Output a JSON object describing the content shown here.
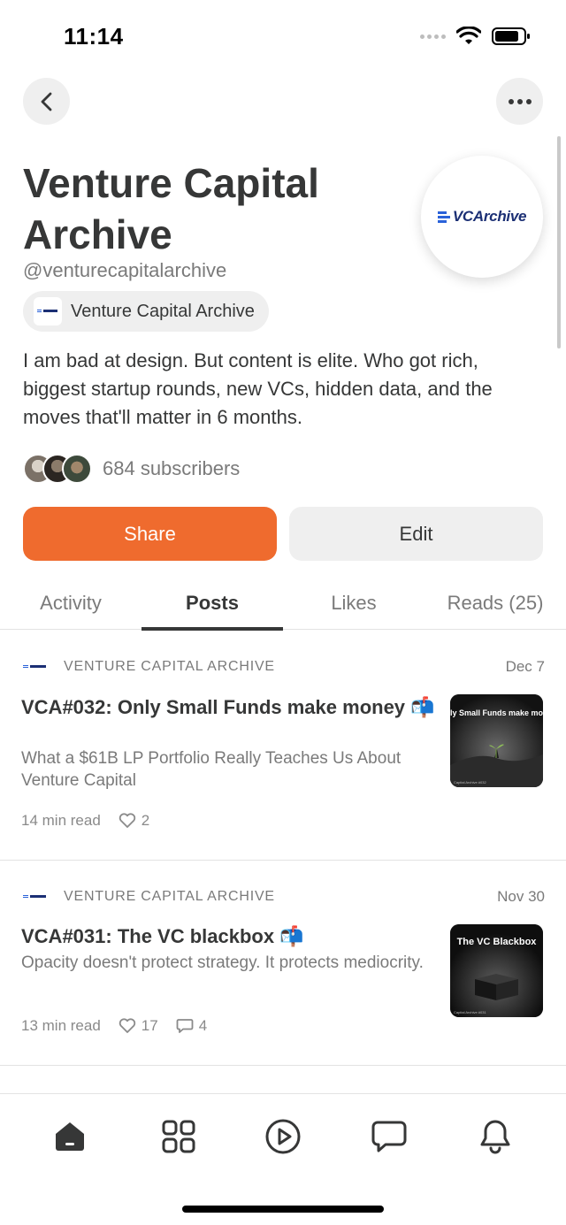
{
  "status_bar": {
    "time": "11:14"
  },
  "profile": {
    "title": "Venture Capital Archive",
    "handle": "@venturecapitalarchive",
    "publication_chip": "Venture Capital Archive",
    "logo_text": "VCArchive",
    "bio": "I am bad at design. But content is elite. Who got rich, biggest startup rounds, new VCs, hidden data, and the moves that'll matter in 6 months.",
    "subscribers_label": "684 subscribers"
  },
  "actions": {
    "share_label": "Share",
    "edit_label": "Edit"
  },
  "tabs": [
    {
      "label": "Activity",
      "active": false
    },
    {
      "label": "Posts",
      "active": true
    },
    {
      "label": "Likes",
      "active": false
    },
    {
      "label": "Reads (25)",
      "active": false
    }
  ],
  "posts": [
    {
      "publication": "VENTURE CAPITAL ARCHIVE",
      "date": "Dec 7",
      "title": "VCA#032: Only Small Funds make money 📬",
      "subtitle": "What a $61B LP Portfolio Really Teaches Us About Venture Capital",
      "read_time": "14 min read",
      "likes": "2",
      "comments": "",
      "thumb_caption": "ly Small Funds make mor",
      "thumb_footer": "Capital Archive #032"
    },
    {
      "publication": "VENTURE CAPITAL ARCHIVE",
      "date": "Nov 30",
      "title": "VCA#031: The VC blackbox 📬",
      "subtitle": "Opacity doesn't protect strategy. It protects mediocrity.",
      "read_time": "13 min read",
      "likes": "17",
      "comments": "4",
      "thumb_caption": "The VC Blackbox",
      "thumb_footer": "Capital Archive #031"
    }
  ],
  "colors": {
    "accent": "#ef6b2e",
    "text": "#363737",
    "muted": "#7a7a7a",
    "chip_bg": "#efefef"
  },
  "icons": [
    "back-icon",
    "more-icon",
    "heart-icon",
    "comment-icon",
    "home-icon",
    "grid-icon",
    "play-icon",
    "chat-icon",
    "bell-icon"
  ]
}
